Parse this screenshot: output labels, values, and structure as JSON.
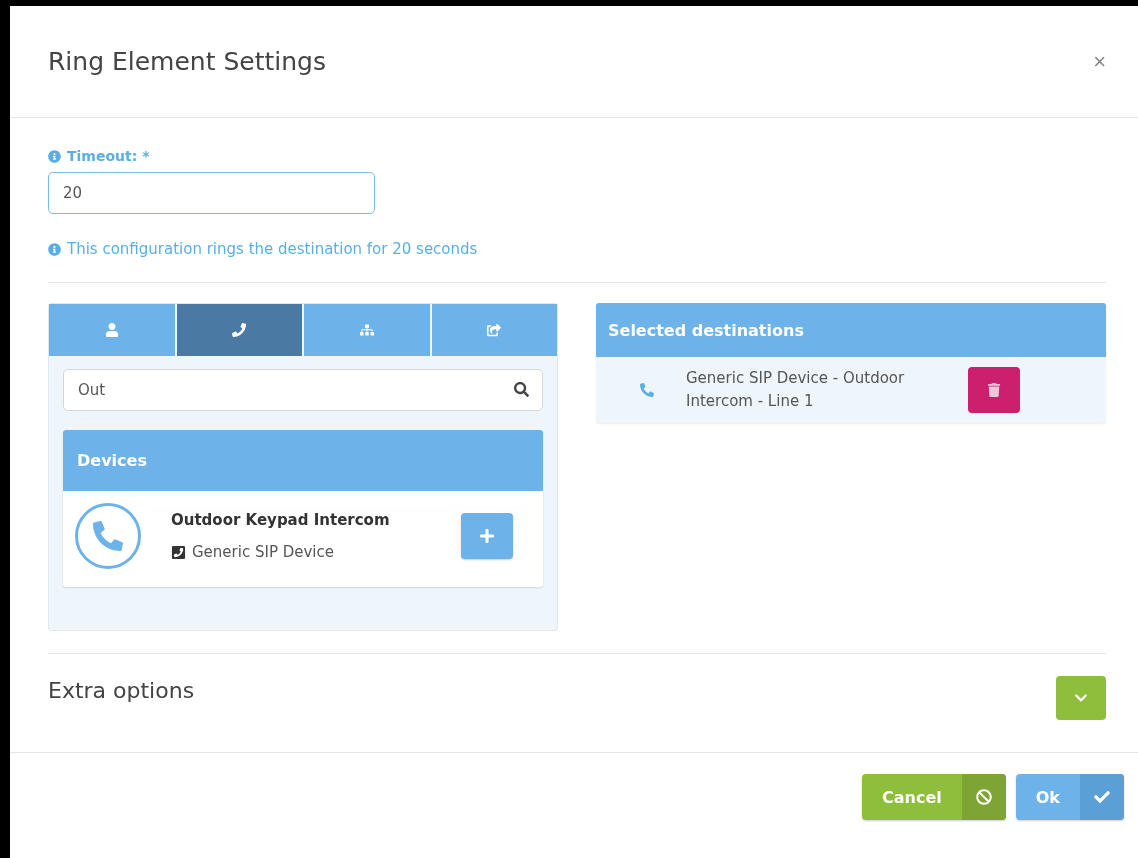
{
  "dialog": {
    "title": "Ring Element Settings",
    "close": "×"
  },
  "timeout": {
    "label": "Timeout:",
    "required": "*",
    "value": "20",
    "hint": "This configuration rings the destination for 20 seconds"
  },
  "tabs": [
    {
      "kind": "user",
      "selected": false
    },
    {
      "kind": "phone",
      "selected": true
    },
    {
      "kind": "group",
      "selected": false
    },
    {
      "kind": "share",
      "selected": false
    }
  ],
  "search": {
    "value": "Out"
  },
  "devices": {
    "title": "Devices",
    "items": [
      {
        "name": "Outdoor Keypad Intercom",
        "type": "Generic SIP Device"
      }
    ]
  },
  "selected_destinations": {
    "title": "Selected destinations",
    "items": [
      {
        "label": "Generic SIP Device - Outdoor Intercom - Line 1"
      }
    ]
  },
  "extra_options": {
    "title": "Extra options",
    "expanded": false
  },
  "buttons": [
    {
      "kind": "cancel",
      "label": "Cancel"
    },
    {
      "kind": "ok",
      "label": "Ok"
    }
  ]
}
